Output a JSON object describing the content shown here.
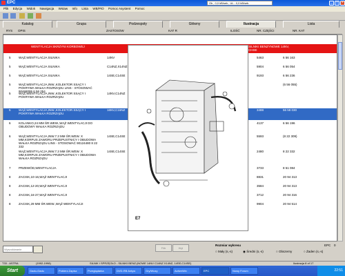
{
  "window": {
    "title": "EPC"
  },
  "menu": [
    "Plik",
    "Edycja",
    "Widok",
    "Nawigacja",
    "Wstaw",
    "Info",
    "Lista",
    "WB/PIO",
    "Pomoc Asystent",
    "Pomoc"
  ],
  "top_status": "Ok , 0,0 kB/sek ; UL : 0,0 kB/sek",
  "tabs": [
    {
      "label": "Katalog",
      "active": false
    },
    {
      "label": "Grupa",
      "active": false
    },
    {
      "label": "Podzespoły",
      "active": false
    },
    {
      "label": "Główny",
      "active": false
    },
    {
      "label": "Ilustracja",
      "active": true
    },
    {
      "label": "Lista",
      "active": false
    }
  ],
  "columns": {
    "lp": "RYS",
    "opis": "OPIS",
    "zastosowanie": "ZASTOSOW",
    "katalog": "KAT R",
    "ilosc": "ILOŚĆ",
    "nr_czesci": "NR. CZĘŚCI",
    "nr_kat": "NR. KAT"
  },
  "section_header": {
    "left": "WENTYLACJA SKRZYNI KORBOWEJ",
    "right": "SILNIKI BENZYNOWE 14NV, CHSE"
  },
  "rows": [
    {
      "no": "5",
      "desc": "WĄŻ,WENTYLACJA SILNIKA",
      "code": "14NV",
      "n1": "5463",
      "n2": "6 56 163",
      "sel": false
    },
    {
      "no": "5",
      "desc": "WĄŻ,WENTYLACJA SILNIKA",
      "code": "C14NZ,X14NZ",
      "n1": "5904",
      "n2": "6 56 054",
      "sel": false
    },
    {
      "no": "5",
      "desc": "WĄŻ,WENTYLACJA SILNIKA",
      "code": "14SE,C14SE",
      "n1": "9193",
      "n2": "6 56 236",
      "sel": false
    },
    {
      "no": "5",
      "desc": "WĄŻ,WENTYLACJA,INW.,KOLEKTOR SSĄCY I POKRYWA WAŁKA ROZRZĄDU LINS - STOSOWAĆ 90468095 6 56 254",
      "code": "",
      "n1": "",
      "n2": "(6 56 055)",
      "sel": false
    },
    {
      "no": "5",
      "desc": "WĄŻ,WENTYLACJA,INW.,KOLEKTOR SSĄCY I POKRYWA WAŁKA ROZRZĄDU",
      "code": "14NV,C14NZ",
      "n1": "",
      "n2": "",
      "sel": false
    },
    {
      "no": "5",
      "desc": "WĄŻ,WENTYLACJA,INW.,KOLEKTOR SSĄCY I POKRYWA WAŁKA ROZRZĄDU",
      "code": "16NV,C16NZ",
      "n1": "3488",
      "n2": "56 58 030",
      "sel": true
    },
    {
      "no": "6",
      "desc": "KOLANKO,24 MM ŚR.WEW.,WĄŻ WENTYLACJI DO OBUDOWY WAŁKA ROZRZĄDU",
      "code": "",
      "n1": "4137",
      "n2": "6 56 196",
      "sel": false
    },
    {
      "no": "6",
      "desc": "WĄŻ,WENTYLACJA,INW.7.3 MM ŚR.WEW. X MM,KORPUS ZAWORU PRZEPUSTNICY I OBUDOWA WAŁKA ROZRZĄDU LINS - STOSOWAĆ 90124480 8 22 332",
      "code": "14SE,C14SE",
      "n1": "5593",
      "n2": "(8 22 309)",
      "sel": false
    },
    {
      "no": "",
      "desc": "WĄŻ,WENTYLACJA,INW.7.3 MM ŚR.WEW. X MM,KORPUS ZAWORU PRZEPUSTNICY I OBUDOWA WAŁKA ROZRZĄDU",
      "code": "14SE,C14SE",
      "n1": "2480",
      "n2": "8 22 332",
      "sel": false
    },
    {
      "no": "7",
      "desc": "PRZEWÓD,WENTYLACJA",
      "code": "",
      "n1": "3733",
      "n2": "8 51 084",
      "sel": false
    },
    {
      "no": "8",
      "desc": "ZACISK,10-16,WĄŻ WENTYLACJI",
      "code": "",
      "n1": "8831",
      "n2": "20 94 313",
      "sel": false
    },
    {
      "no": "8",
      "desc": "ZACISK,12-20,WĄŻ WENTYLACJI",
      "code": "",
      "n1": "3584",
      "n2": "20 94 313",
      "sel": false
    },
    {
      "no": "8",
      "desc": "ZACISK,16-27,WĄŻ WENTYLACJI",
      "code": "",
      "n1": "3712",
      "n2": "20 94 316",
      "sel": false
    },
    {
      "no": "8",
      "desc": "ZACISK,29 MM ŚR.WEW.,WĄŻ WENTYLACJI",
      "code": "",
      "n1": "9904",
      "n2": "20 94 514",
      "sel": false
    }
  ],
  "illustration_label": "E7",
  "bottom": {
    "search_placeholder": "Wyszukiwanie",
    "buttons": [
      "Filtr",
      "Wyl"
    ],
    "size_label": "Rozmiar wykresu",
    "size_options": [
      {
        "label": "Mały (s,-s)",
        "checked": false
      },
      {
        "label": "Średni (s,-s)",
        "checked": true
      },
      {
        "label": "Obszerny",
        "checked": false
      },
      {
        "label": "Żaden (s,-s)",
        "checked": false
      }
    ],
    "right_label": "EPC",
    "right_value": "0"
  },
  "statusbar": {
    "left": "T33 - ASTRA",
    "mid": "(1992-1998)",
    "info": "SILNIK I SPRZĘGŁO - SILNIKI BENZ.(NOWE 14NV C14NZ X14NZ, 14SE,C14SE)",
    "right": "Ilustracja 8 of 17"
  },
  "taskbar": {
    "start": "Start",
    "items": [
      "Gadu-Gadu",
      "Pobierz.Zapisz",
      "Przeglądarka",
      "DVD-RB Antyw",
      "Gry/Wozy",
      "ActiveWin",
      "EPC",
      "Nowy Forum"
    ],
    "clock": "22:51"
  }
}
